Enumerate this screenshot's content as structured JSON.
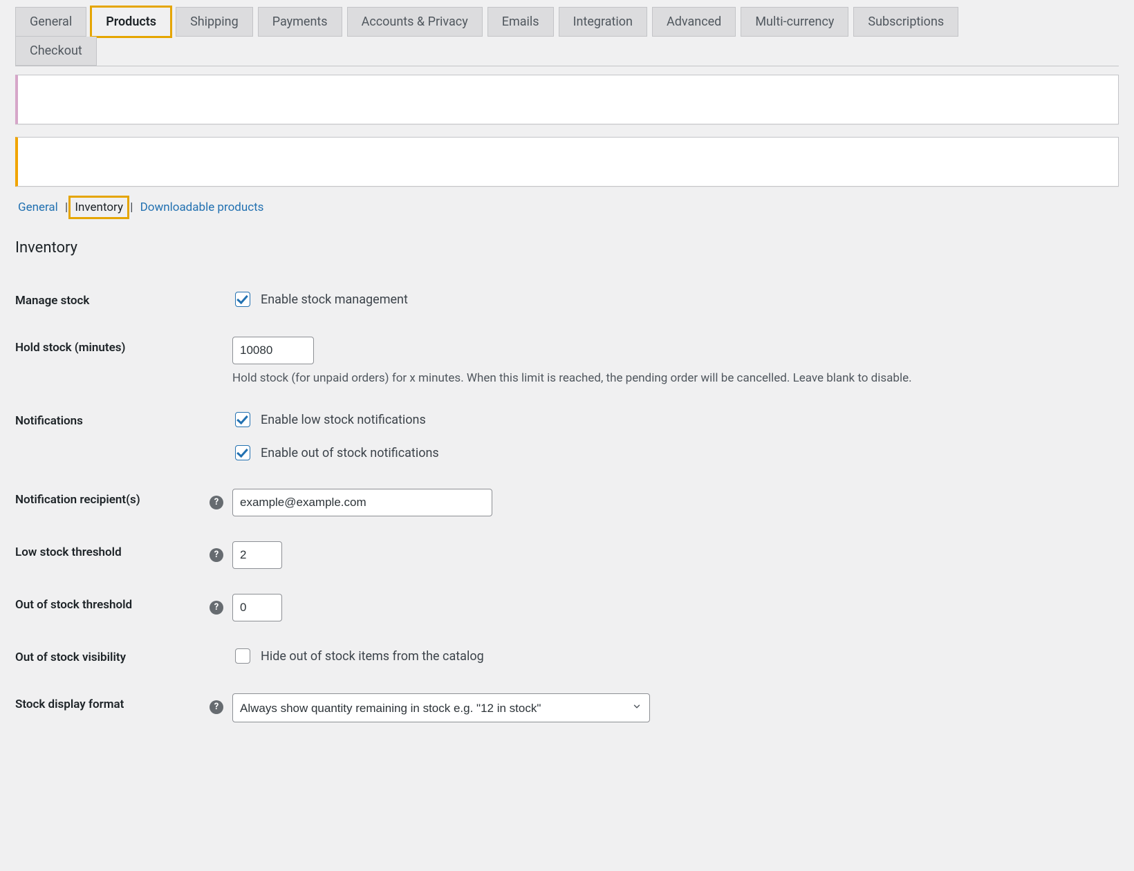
{
  "tabs": {
    "main": [
      {
        "label": "General",
        "active": false,
        "highlighted": false
      },
      {
        "label": "Products",
        "active": true,
        "highlighted": true
      },
      {
        "label": "Shipping",
        "active": false,
        "highlighted": false
      },
      {
        "label": "Payments",
        "active": false,
        "highlighted": false
      },
      {
        "label": "Accounts & Privacy",
        "active": false,
        "highlighted": false
      },
      {
        "label": "Emails",
        "active": false,
        "highlighted": false
      },
      {
        "label": "Integration",
        "active": false,
        "highlighted": false
      },
      {
        "label": "Advanced",
        "active": false,
        "highlighted": false
      },
      {
        "label": "Multi-currency",
        "active": false,
        "highlighted": false
      },
      {
        "label": "Subscriptions",
        "active": false,
        "highlighted": false
      }
    ],
    "second_row": [
      {
        "label": "Checkout",
        "active": false,
        "highlighted": false
      }
    ]
  },
  "subnav": {
    "items": [
      {
        "label": "General",
        "current": false,
        "highlighted": false
      },
      {
        "label": "Inventory",
        "current": true,
        "highlighted": true
      },
      {
        "label": "Downloadable products",
        "current": false,
        "highlighted": false
      }
    ]
  },
  "section_title": "Inventory",
  "fields": {
    "manage_stock": {
      "label": "Manage stock",
      "checkbox_label": "Enable stock management",
      "checked": true
    },
    "hold_stock": {
      "label": "Hold stock (minutes)",
      "value": "10080",
      "description": "Hold stock (for unpaid orders) for x minutes. When this limit is reached, the pending order will be cancelled. Leave blank to disable."
    },
    "notifications": {
      "label": "Notifications",
      "low_stock_label": "Enable low stock notifications",
      "low_stock_checked": true,
      "out_of_stock_label": "Enable out of stock notifications",
      "out_of_stock_checked": true
    },
    "recipients": {
      "label": "Notification recipient(s)",
      "value": "example@example.com"
    },
    "low_threshold": {
      "label": "Low stock threshold",
      "value": "2"
    },
    "oos_threshold": {
      "label": "Out of stock threshold",
      "value": "0"
    },
    "oos_visibility": {
      "label": "Out of stock visibility",
      "checkbox_label": "Hide out of stock items from the catalog",
      "checked": false
    },
    "stock_display": {
      "label": "Stock display format",
      "selected": "Always show quantity remaining in stock e.g. \"12 in stock\""
    }
  }
}
